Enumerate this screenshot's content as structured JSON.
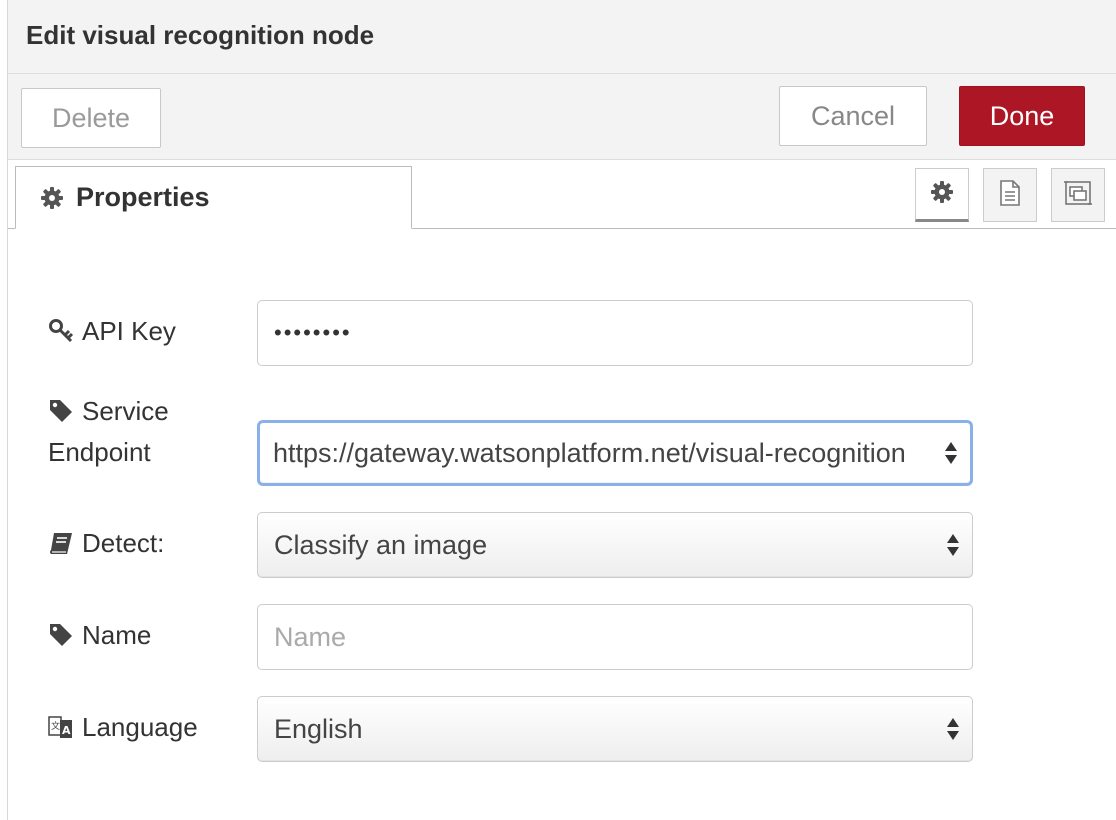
{
  "header": {
    "title": "Edit visual recognition node"
  },
  "toolbar": {
    "delete_label": "Delete",
    "cancel_label": "Cancel",
    "done_label": "Done",
    "done_color": "#ad1625"
  },
  "tabs": {
    "properties_label": "Properties",
    "properties_icon": "gear-icon",
    "side_buttons": [
      "gear-icon",
      "document-icon",
      "node-appearance-icon"
    ]
  },
  "form": {
    "api_key": {
      "label": "API Key",
      "icon": "key-icon",
      "value": "••••••••"
    },
    "service_endpoint": {
      "label_line1": "Service",
      "label_line2": "Endpoint",
      "icon": "tag-icon",
      "value": "https://gateway.watsonplatform.net/visual-recognition"
    },
    "detect": {
      "label": "Detect:",
      "icon": "book-icon",
      "value": "Classify an image"
    },
    "name": {
      "label": "Name",
      "icon": "tag-icon",
      "value": "",
      "placeholder": "Name"
    },
    "language": {
      "label": "Language",
      "icon": "language-icon",
      "value": "English"
    }
  }
}
